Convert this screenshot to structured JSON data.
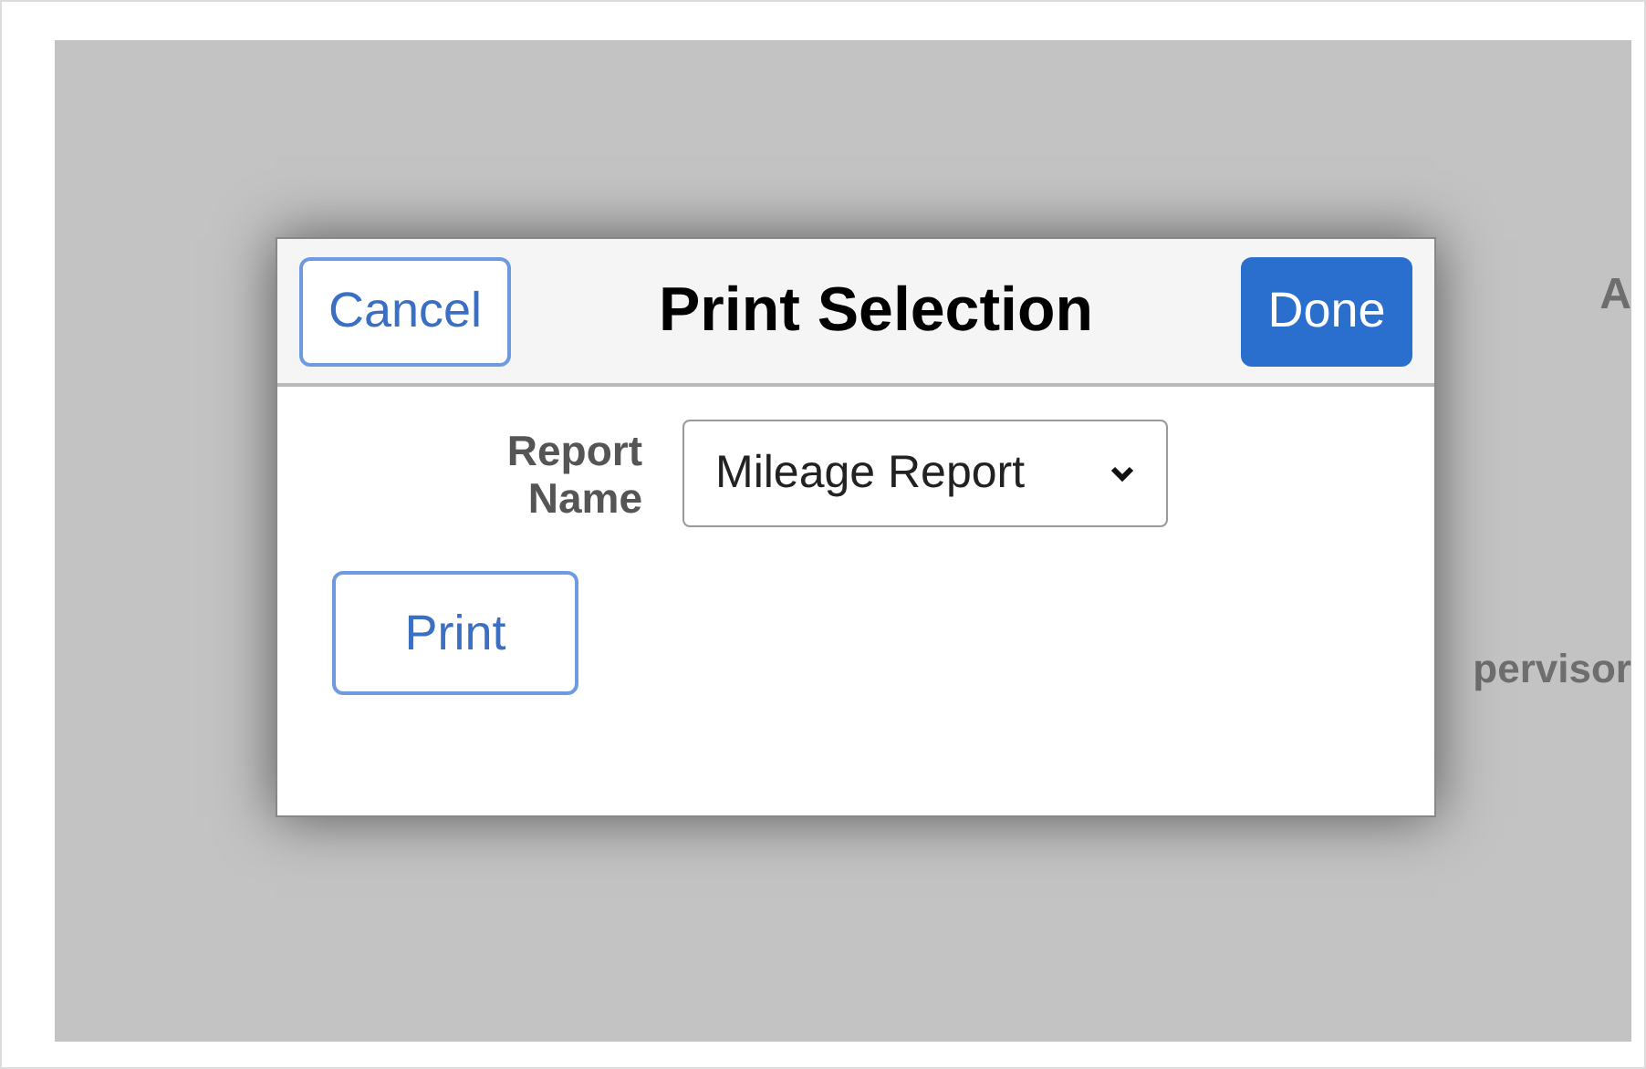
{
  "background_texts": [
    "A",
    "pervisor"
  ],
  "dialog": {
    "cancel_button": "Cancel",
    "title": "Print Selection",
    "done_button": "Done",
    "report_field": {
      "label": "Report Name",
      "value": "Mileage Report"
    },
    "print_button": "Print"
  }
}
